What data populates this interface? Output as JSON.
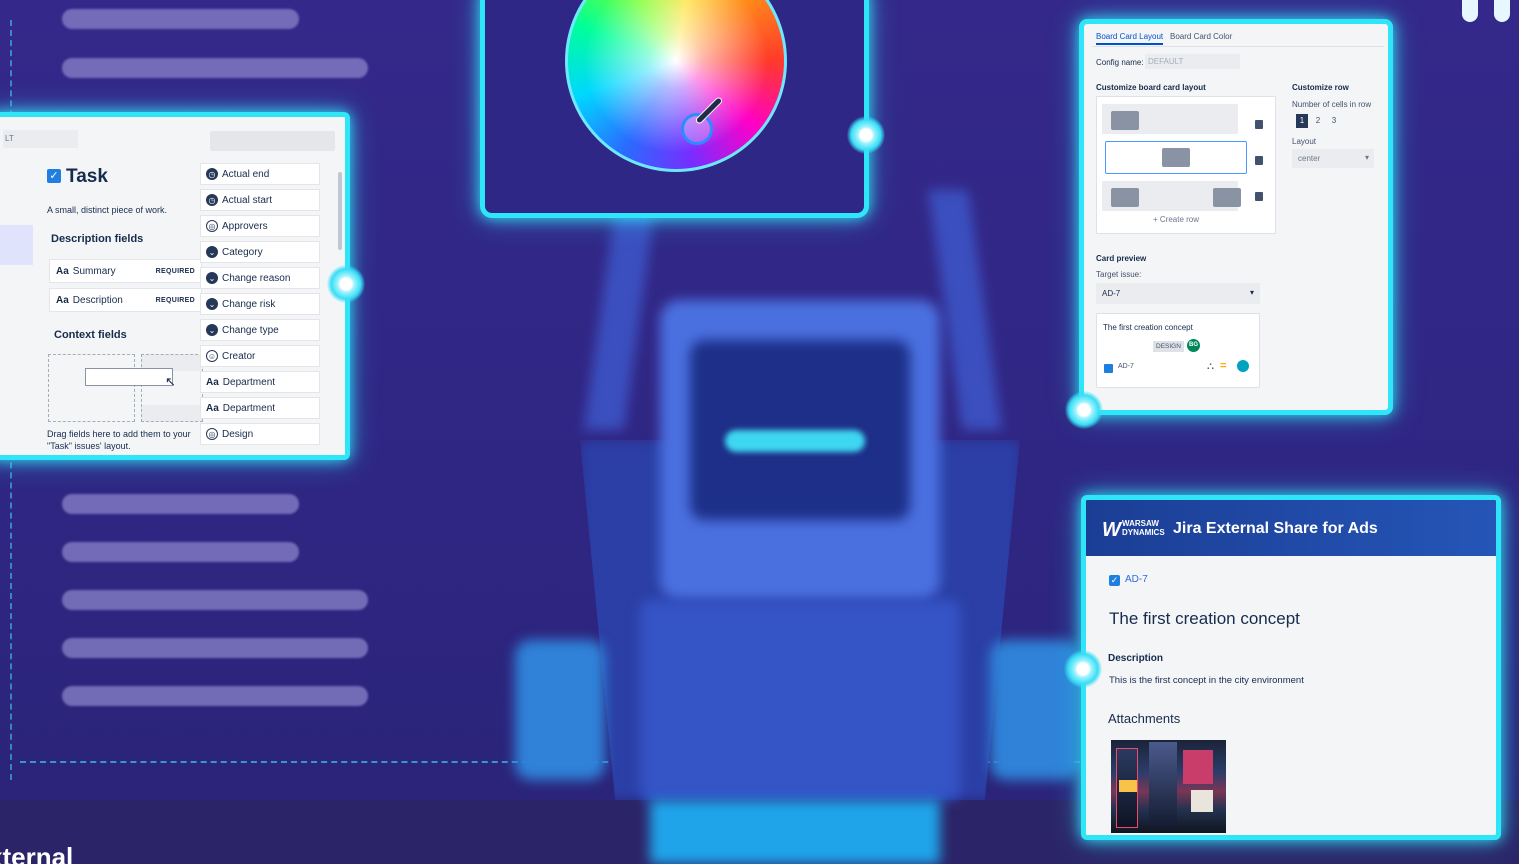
{
  "task_panel": {
    "tab_partial": "LT",
    "title": "Task",
    "subtitle": "A small, distinct piece of work.",
    "description_fields_heading": "Description fields",
    "description_fields": [
      {
        "label": "Summary",
        "badge": "REQUIRED"
      },
      {
        "label": "Description",
        "badge": "REQUIRED"
      }
    ],
    "context_fields_heading": "Context fields",
    "drag_hint": "Drag fields here to add them to your \"Task\" issues' layout.",
    "fields": [
      {
        "label": "Actual end",
        "icon": "clock-icon"
      },
      {
        "label": "Actual start",
        "icon": "clock-icon"
      },
      {
        "label": "Approvers",
        "icon": "target-icon"
      },
      {
        "label": "Category",
        "icon": "chevron-circle-icon"
      },
      {
        "label": "Change reason",
        "icon": "chevron-circle-icon"
      },
      {
        "label": "Change risk",
        "icon": "chevron-circle-icon"
      },
      {
        "label": "Change type",
        "icon": "chevron-circle-icon"
      },
      {
        "label": "Creator",
        "icon": "user-circle-icon"
      },
      {
        "label": "Department",
        "icon": "text-aa-icon"
      },
      {
        "label": "Department",
        "icon": "text-aa-icon"
      },
      {
        "label": "Design",
        "icon": "target-icon"
      }
    ]
  },
  "board_card": {
    "tabs": [
      "Board Card Layout",
      "Board Card Color"
    ],
    "config_label": "Config name:",
    "config_value": "DEFAULT",
    "customize_layout_heading": "Customize board card layout",
    "create_row": "+ Create row",
    "customize_row_heading": "Customize row",
    "cells_label": "Number of cells in row",
    "cell_options": [
      "1",
      "2",
      "3"
    ],
    "layout_label": "Layout",
    "layout_value": "center",
    "card_preview_heading": "Card preview",
    "target_issue_label": "Target issue:",
    "target_issue_value": "AD-7",
    "preview_title": "The first creation concept",
    "preview_label": "DESIGN",
    "preview_avatar": "BG",
    "preview_key": "AD-7"
  },
  "jira_share": {
    "logo_text": "WARSAW DYNAMICS",
    "title": "Jira External Share for Ads",
    "issue_key": "AD-7",
    "issue_title": "The first creation concept",
    "description_heading": "Description",
    "description_text": "This is the first concept in the city environment",
    "attachments_heading": "Attachments"
  },
  "footer_partial_text": "xternal",
  "colors": {
    "background": "#32288a",
    "glow": "#2ee6f8",
    "jira_header": "#1e4aa8",
    "check": "#0052cc"
  }
}
